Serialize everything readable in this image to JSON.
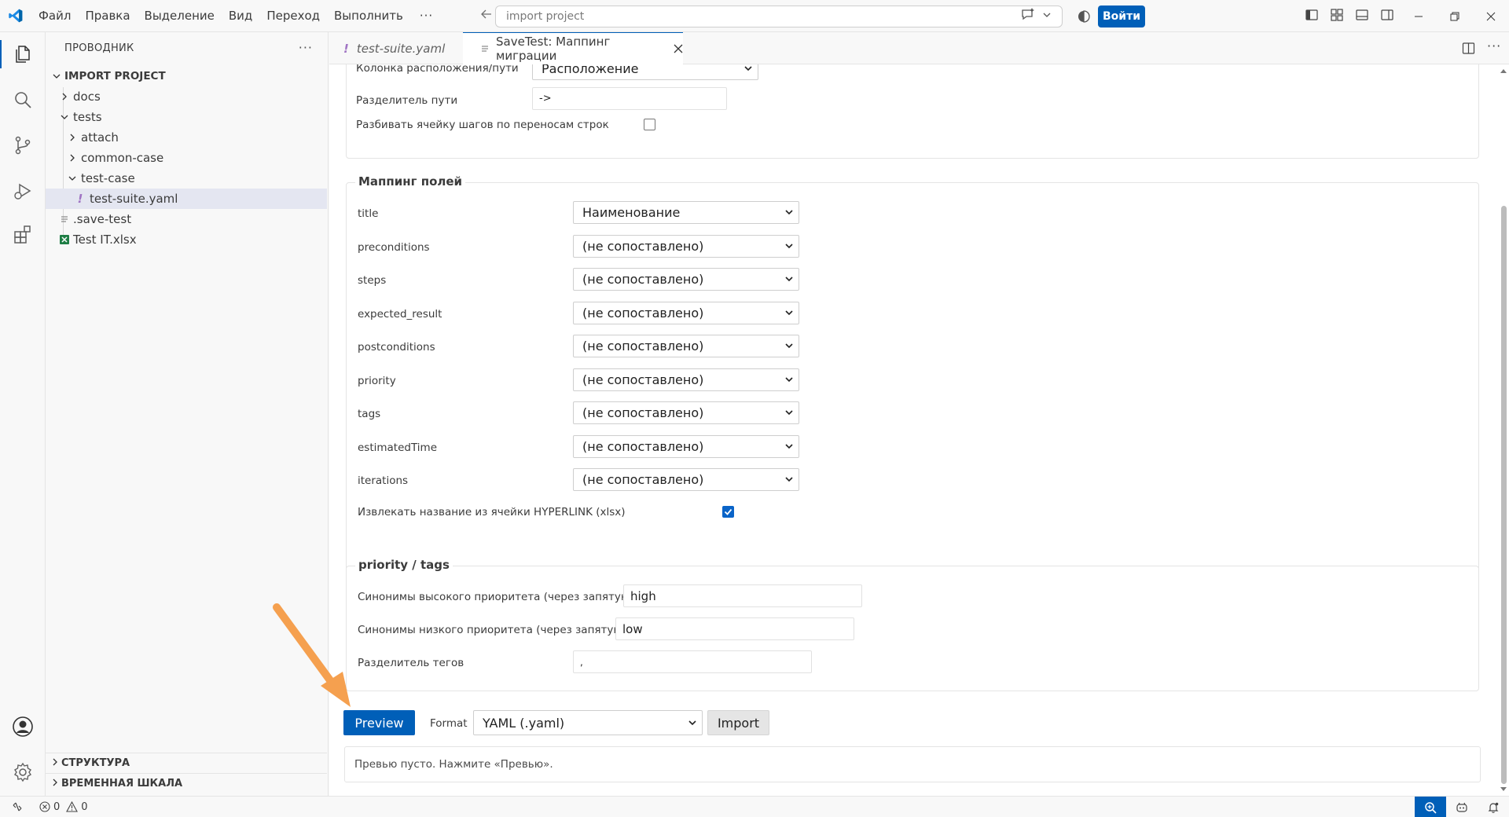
{
  "titlebar": {
    "menu": [
      "Файл",
      "Правка",
      "Выделение",
      "Вид",
      "Переход",
      "Выполнить"
    ],
    "more": "···",
    "search_placeholder": "import project",
    "signin_label": "Войти"
  },
  "sidebar": {
    "title": "ПРОВОДНИК",
    "more": "···",
    "root": "IMPORT PROJECT",
    "items": [
      {
        "label": "docs"
      },
      {
        "label": "tests"
      },
      {
        "label": "attach"
      },
      {
        "label": "common-case"
      },
      {
        "label": "test-case"
      },
      {
        "label": "test-suite.yaml",
        "icon_glyph": "!"
      },
      {
        "label": ".save-test"
      },
      {
        "label": "Test IT.xlsx"
      }
    ],
    "sections": [
      "СТРУКТУРА",
      "ВРЕМЕННАЯ ШКАЛА"
    ]
  },
  "tabs": [
    {
      "label": "test-suite.yaml",
      "icon_glyph": "!"
    },
    {
      "label": "SaveTest: Маппинг миграции"
    }
  ],
  "top_panel": {
    "location_label": "Колонка расположения/пути",
    "location_value": "Расположение",
    "path_sep_label": "Разделитель пути",
    "path_sep_value": "->",
    "split_steps_label": "Разбивать ячейку шагов по переносам строк"
  },
  "mapping": {
    "legend": "Маппинг полей",
    "fields": [
      {
        "label": "title",
        "value": "Наименование"
      },
      {
        "label": "preconditions",
        "value": "(не сопоставлено)"
      },
      {
        "label": "steps",
        "value": "(не сопоставлено)"
      },
      {
        "label": "expected_result",
        "value": "(не сопоставлено)"
      },
      {
        "label": "postconditions",
        "value": "(не сопоставлено)"
      },
      {
        "label": "priority",
        "value": "(не сопоставлено)"
      },
      {
        "label": "tags",
        "value": "(не сопоставлено)"
      },
      {
        "label": "estimatedTime",
        "value": "(не сопоставлено)"
      },
      {
        "label": "iterations",
        "value": "(не сопоставлено)"
      }
    ],
    "hyperlink_label": "Извлекать название из ячейки HYPERLINK (xlsx)"
  },
  "priority_tags": {
    "legend": "priority / tags",
    "high_label": "Синонимы высокого приоритета (через запятую)",
    "high_value": "high",
    "low_label": "Синонимы низкого приоритета (через запятую)",
    "low_value": "low",
    "tag_sep_label": "Разделитель тегов",
    "tag_sep_value": ","
  },
  "actions": {
    "preview_label": "Preview",
    "format_label": "Format",
    "format_value": "YAML (.yaml)",
    "import_label": "Import"
  },
  "preview_text": "Превью пусто. Нажмите «Превью».",
  "statusbar": {
    "errors": "0",
    "warnings": "0"
  },
  "colors": {
    "accent": "#005fb8",
    "annotation_arrow": "#f5a04f"
  }
}
